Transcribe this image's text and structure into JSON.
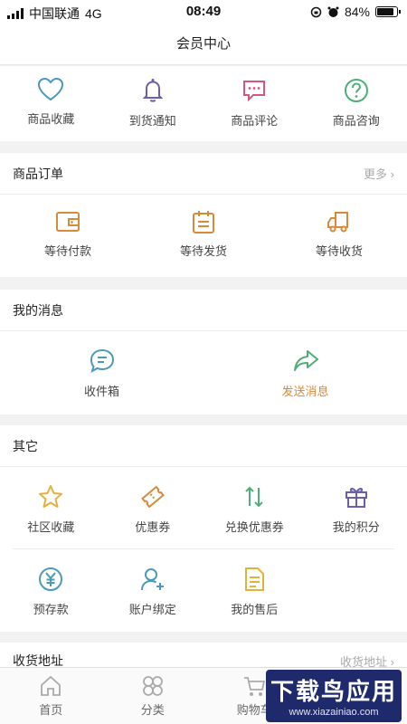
{
  "status_bar": {
    "carrier": "中国联通",
    "network": "4G",
    "time": "08:49",
    "battery": "84%"
  },
  "header": {
    "title": "会员中心"
  },
  "shortcuts": [
    {
      "label": "商品收藏",
      "icon": "heart-icon"
    },
    {
      "label": "到货通知",
      "icon": "bell-icon"
    },
    {
      "label": "商品评论",
      "icon": "comment-icon"
    },
    {
      "label": "商品咨询",
      "icon": "question-icon"
    }
  ],
  "orders": {
    "title": "商品订单",
    "more": "更多",
    "items": [
      {
        "label": "等待付款",
        "icon": "wallet-icon"
      },
      {
        "label": "等待发货",
        "icon": "calendar-icon"
      },
      {
        "label": "等待收货",
        "icon": "truck-icon"
      }
    ]
  },
  "messages": {
    "title": "我的消息",
    "items": [
      {
        "label": "收件箱",
        "icon": "chat-bubble-icon"
      },
      {
        "label": "发送消息",
        "icon": "share-arrow-icon"
      }
    ]
  },
  "other": {
    "title": "其它",
    "row1": [
      {
        "label": "社区收藏",
        "icon": "star-icon"
      },
      {
        "label": "优惠券",
        "icon": "coupon-icon"
      },
      {
        "label": "兑换优惠券",
        "icon": "exchange-icon"
      },
      {
        "label": "我的积分",
        "icon": "gift-icon"
      }
    ],
    "row2": [
      {
        "label": "预存款",
        "icon": "yen-icon"
      },
      {
        "label": "账户绑定",
        "icon": "user-add-icon"
      },
      {
        "label": "我的售后",
        "icon": "document-icon"
      }
    ]
  },
  "address": {
    "title": "收货地址",
    "more": "收货地址"
  },
  "tabbar": [
    {
      "label": "首页",
      "icon": "home-icon"
    },
    {
      "label": "分类",
      "icon": "category-icon"
    },
    {
      "label": "购物车",
      "icon": "cart-icon"
    }
  ],
  "watermark": {
    "title": "下载鸟应用",
    "url": "www.xiazainiao.com"
  },
  "colors": {
    "accent_blue": "#4a9ab8",
    "accent_orange": "#d9893a",
    "accent_pink": "#d9557d",
    "accent_green": "#4fae78",
    "accent_purple": "#6b5fa8",
    "accent_yellow": "#e2b23c"
  }
}
